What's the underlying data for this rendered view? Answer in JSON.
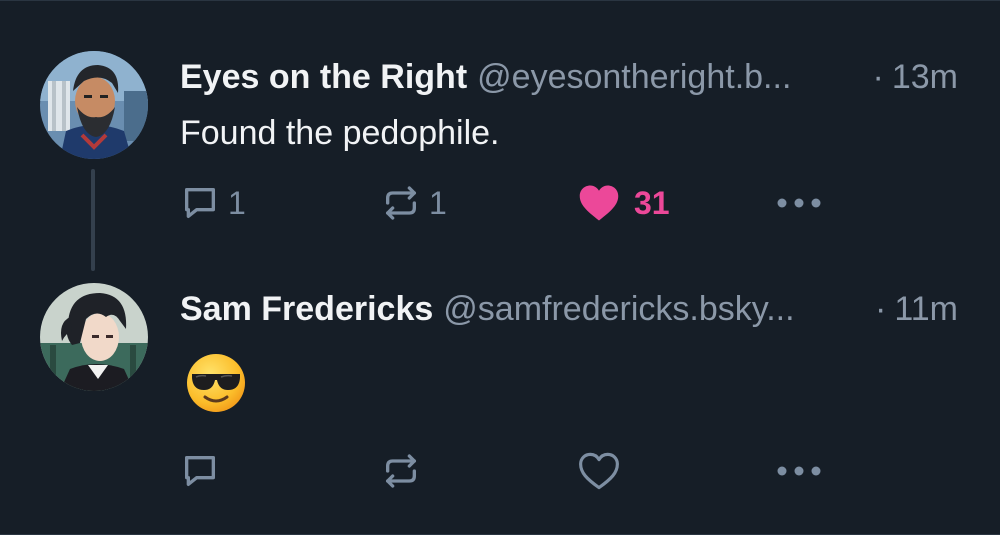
{
  "posts": [
    {
      "display_name": "Eyes on the Right",
      "handle": "@eyesontheright.b...",
      "separator": "·",
      "timestamp": "13m",
      "text": "Found the pedophile.",
      "replies": "1",
      "reposts": "1",
      "likes": "31",
      "liked": true,
      "avatar_icon": "cartoon-bearded-man-avatar"
    },
    {
      "display_name": "Sam Fredericks",
      "handle": "@samfredericks.bsky...",
      "separator": "·",
      "timestamp": "11m",
      "text": "",
      "emoji_icon": "smiling-face-with-sunglasses-emoji",
      "replies": "",
      "reposts": "",
      "likes": "",
      "liked": false,
      "avatar_icon": "anime-dark-haired-man-avatar"
    }
  ],
  "icons": {
    "reply": "reply-bubble-icon",
    "repost": "repost-arrows-icon",
    "like": "heart-icon",
    "more": "more-dots-icon"
  },
  "colors": {
    "background": "#161e27",
    "text_primary": "#f1f3f5",
    "text_secondary": "#8b98a8",
    "icon": "#7d8ea2",
    "like_active": "#ec4899"
  }
}
